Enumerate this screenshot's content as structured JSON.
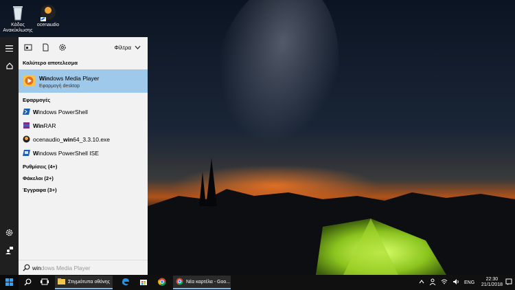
{
  "desktop": {
    "icons": [
      {
        "label": "Κάδος Ανακύκλωσης",
        "icon": "recycle-bin-icon"
      },
      {
        "label": "ocenaudio",
        "icon": "ocenaudio-icon"
      }
    ]
  },
  "start_menu": {
    "filters_label": "Φίλτρα",
    "best_match_header": "Καλύτερο αποτελεσμα",
    "best_match": {
      "bold": "Win",
      "rest": "dows Media Player",
      "subtitle": "Εφαρμογή desktop"
    },
    "apps_header": "Εφαρμογές",
    "apps": [
      {
        "bold": "W",
        "rest": "indows PowerShell",
        "icon": "powershell-icon"
      },
      {
        "bold": "Win",
        "rest": "RAR",
        "icon": "winrar-icon"
      },
      {
        "pre": "ocenaudio_",
        "bold": "win",
        "rest": "64_3.3.10.exe",
        "icon": "ocenaudio-icon"
      },
      {
        "bold": "W",
        "rest": "indows PowerShell ISE",
        "icon": "powershell-ise-icon"
      }
    ],
    "categories": [
      "Ρυθμίσεις (4+)",
      "Φάκελοι (2+)",
      "Έγγραφα (3+)"
    ],
    "search": {
      "typed": "win",
      "hint": "dows Media Player"
    }
  },
  "taskbar": {
    "tasks": [
      {
        "label": "Στιγμιότυπα οθόνης",
        "icon": "folder-icon"
      },
      {
        "label": "Νέα καρτέλα - Goo...",
        "icon": "chrome-icon"
      }
    ],
    "language": "ENG",
    "time": "22:30",
    "date": "21/1/2018"
  },
  "colors": {
    "accent": "#0078d7",
    "highlight": "#9ec9ea",
    "taskbar": "#101010",
    "panel": "#f2f2f2"
  }
}
